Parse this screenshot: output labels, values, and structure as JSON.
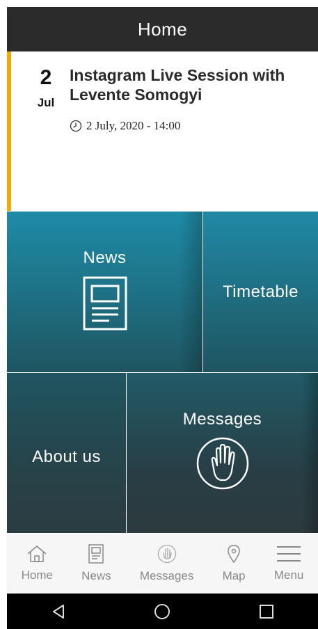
{
  "header": {
    "title": "Home"
  },
  "event": {
    "day": "2",
    "month": "Jul",
    "title": "Instagram Live Session with Levente Somogyi",
    "datetime": "2 July, 2020 - 14:00",
    "accent_color": "#f4a70b",
    "icon": "clock-icon"
  },
  "tiles": [
    {
      "label": "News",
      "icon": "newspaper-icon"
    },
    {
      "label": "Timetable"
    },
    {
      "label": "About us"
    },
    {
      "label": "Messages",
      "icon": "hand-icon"
    }
  ],
  "bottom_nav": [
    {
      "label": "Home",
      "icon": "home-icon"
    },
    {
      "label": "News",
      "icon": "news-icon"
    },
    {
      "label": "Messages",
      "icon": "hand-icon"
    },
    {
      "label": "Map",
      "icon": "map-pin-icon"
    },
    {
      "label": "Menu",
      "icon": "hamburger-icon"
    }
  ],
  "system_nav": [
    "back-icon",
    "home-circle-icon",
    "recents-icon"
  ]
}
